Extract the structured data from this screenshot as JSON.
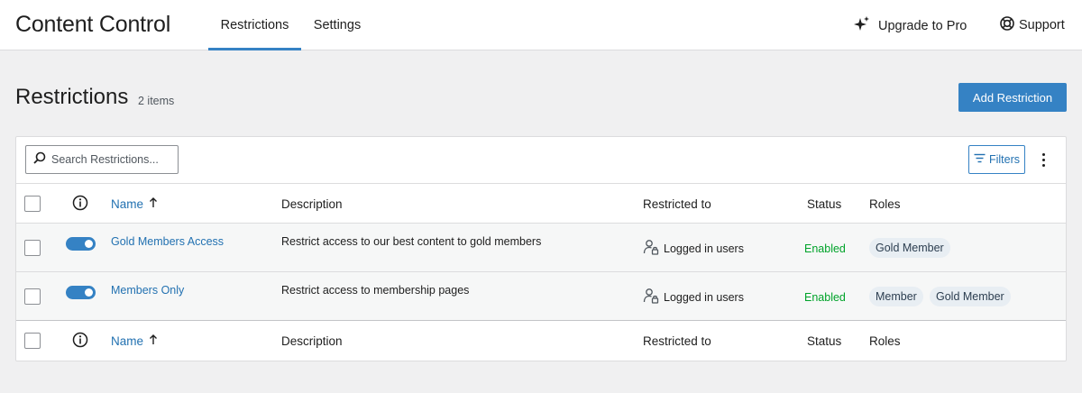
{
  "app": {
    "title": "Content Control"
  },
  "nav": {
    "tabs": [
      {
        "label": "Restrictions"
      },
      {
        "label": "Settings"
      }
    ],
    "upgrade_label": "Upgrade to Pro",
    "support_label": "Support"
  },
  "page": {
    "title": "Restrictions",
    "count": "2 items",
    "add_button": "Add Restriction"
  },
  "toolbar": {
    "search_placeholder": "Search Restrictions...",
    "filters_label": "Filters"
  },
  "columns": {
    "name": "Name",
    "description": "Description",
    "restricted_to": "Restricted to",
    "status": "Status",
    "roles": "Roles"
  },
  "rows": [
    {
      "enabled": true,
      "name": "Gold Members Access",
      "description": "Restrict access to our best content to gold members",
      "restricted_to": "Logged in users",
      "status": "Enabled",
      "roles": [
        "Gold Member"
      ]
    },
    {
      "enabled": true,
      "name": "Members Only",
      "description": "Restrict access to membership pages",
      "restricted_to": "Logged in users",
      "status": "Enabled",
      "roles": [
        "Member",
        "Gold Member"
      ]
    }
  ],
  "colors": {
    "accent": "#3582c4",
    "link": "#2271b1",
    "status_enabled": "#00a32a",
    "background": "#f0f0f1"
  }
}
